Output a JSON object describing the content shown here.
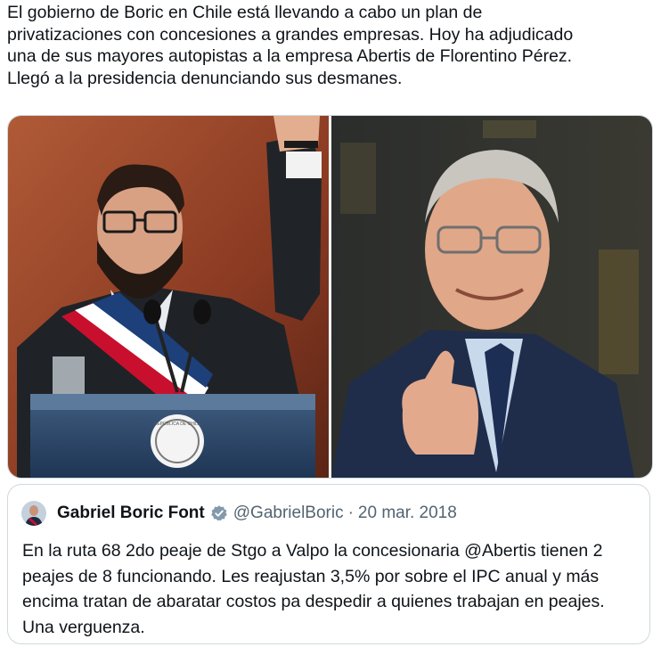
{
  "tweet": {
    "text": "El gobierno de Boric en Chile está llevando a cabo un plan de\nprivatizaciones con concesiones a grandes empresas. Hoy ha adjudicado\nuna de sus mayores autopistas a la empresa Abertis de Florentino Pérez.\nLlegó a la presidencia denunciando sus desmanes."
  },
  "media": {
    "left_photo": "boric-photo",
    "right_photo": "perez-photo",
    "podium_seal_text": "REPÚBLICA DE CHILE"
  },
  "quoted": {
    "name": "Gabriel Boric Font",
    "handle": "@GabrielBoric",
    "separator": "·",
    "date": "20 mar. 2018",
    "text": "En la ruta 68 2do peaje de Stgo a Valpo la concesionaria @Abertis tienen 2 peajes de 8 funcionando. Les reajustan 3,5% por sobre el IPC anual y más encima tratan de abaratar costos pa despedir a quienes trabajan en peajes. Una verguenza.",
    "verified_icon": "verified-badge-icon",
    "verified_color": "#829aab"
  }
}
